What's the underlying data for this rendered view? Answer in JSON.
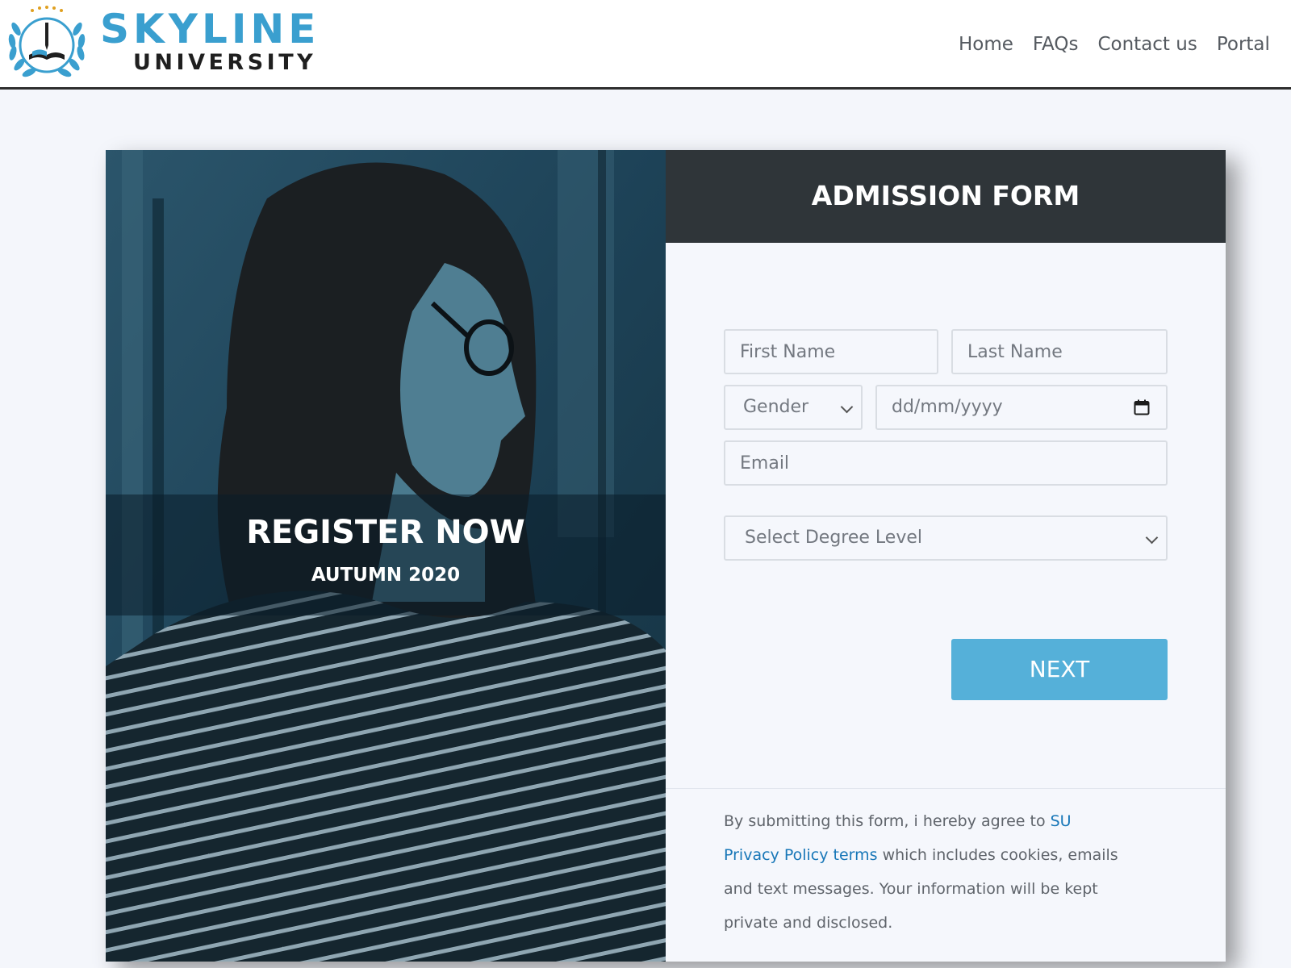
{
  "brand": {
    "name_main": "SKYLINE",
    "name_sub": "UNIVERSITY",
    "colors": {
      "primary": "#3a9fcf",
      "dark": "#1f1f1f"
    }
  },
  "nav": {
    "items": [
      {
        "label": "Home"
      },
      {
        "label": "FAQs"
      },
      {
        "label": "Contact us"
      },
      {
        "label": "Portal"
      }
    ]
  },
  "hero": {
    "title": "REGISTER NOW",
    "subtitle": "AUTUMN 2020"
  },
  "form": {
    "title": "ADMISSION FORM",
    "first_name": {
      "placeholder": "First Name",
      "value": ""
    },
    "last_name": {
      "placeholder": "Last Name",
      "value": ""
    },
    "gender": {
      "selected": "Gender"
    },
    "dob": {
      "placeholder": "dd/mm/yyyy"
    },
    "email": {
      "placeholder": "Email",
      "value": ""
    },
    "degree_level": {
      "selected": "Select Degree Level"
    },
    "next_label": "NEXT",
    "colors": {
      "header_bg": "#2f3539",
      "button_bg": "#55b0d9",
      "link": "#1877b8"
    }
  },
  "disclaimer": {
    "text_1": "By submitting this form, i hereby agree to ",
    "link": "SU Privacy Policy terms",
    "text_2": " which includes cookies, emails and text messages. Your information will be kept private and disclosed."
  },
  "icons": {
    "logo": "university-laurel-logo-icon",
    "select_arrow": "chevron-down-icon",
    "date_picker": "calendar-icon"
  }
}
